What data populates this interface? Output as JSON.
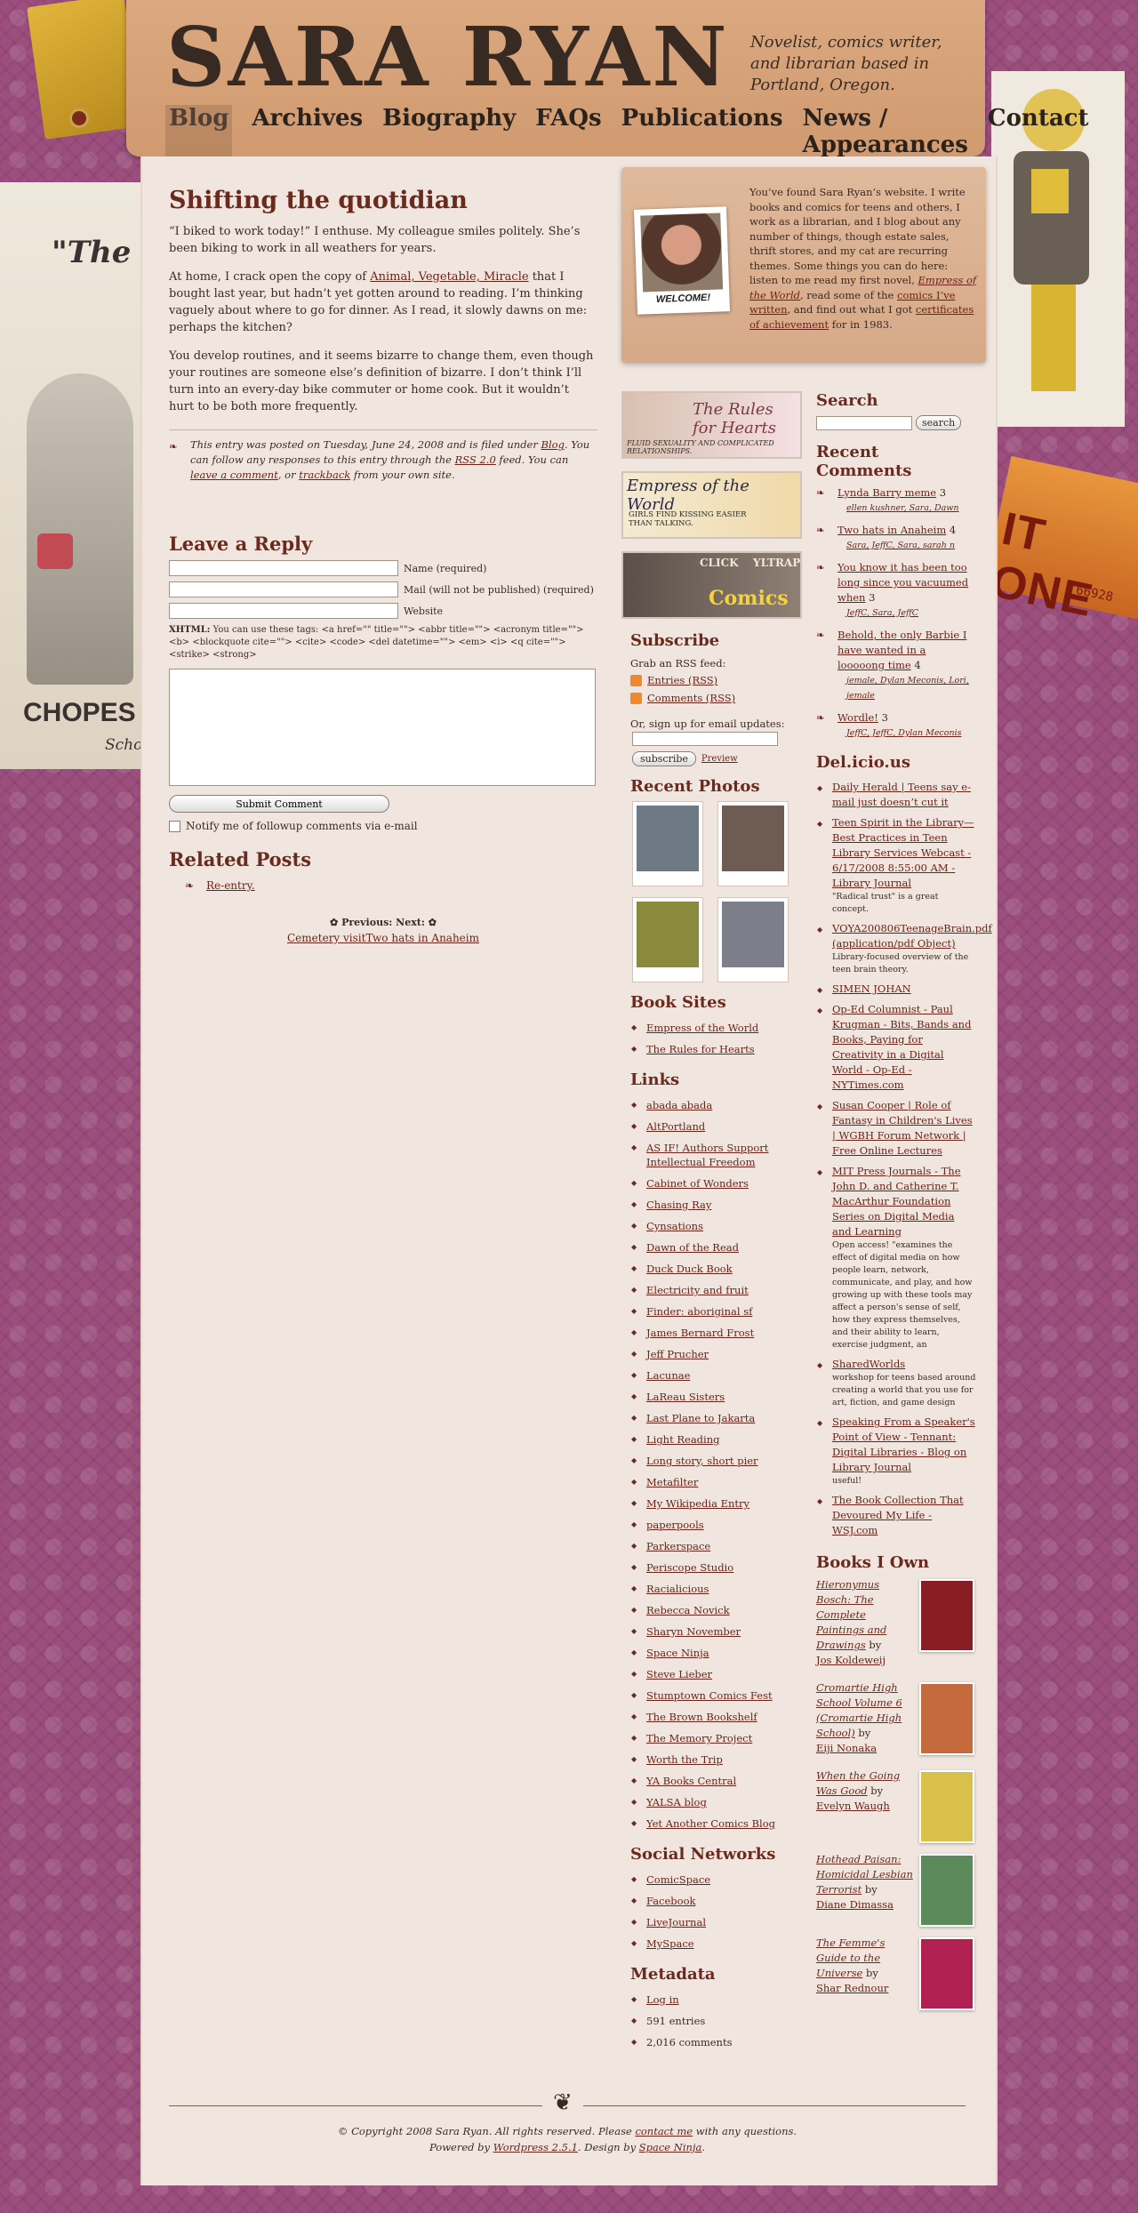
{
  "site": {
    "title": "SARA RYAN",
    "tagline": "Novelist, comics writer, and librarian based in Portland, Oregon."
  },
  "nav": [
    "Blog",
    "Archives",
    "Biography",
    "FAQs",
    "Publications",
    "News / Appearances",
    "Contact"
  ],
  "decor": {
    "poster_quote": "\"The Ri Answe Your I",
    "poster_bottom": "CHOPES",
    "poster_sub": "Scho",
    "ticket_text": "IT ONE",
    "ticket_num": "66928"
  },
  "post": {
    "title": "Shifting the quotidian",
    "p1": "“I biked to work today!” I enthuse. My colleague smiles politely. She’s been biking to work in all weathers for years.",
    "p2_before": "At home, I crack open the copy of ",
    "p2_link": "Animal, Vegetable, Miracle",
    "p2_after": " that I bought last year, but hadn’t yet gotten around to reading. I’m thinking vaguely about where to go for dinner. As I read, it slowly dawns on me: perhaps the kitchen?",
    "p3": "You develop routines, and it seems bizarre to change them, even though your routines are someone else’s definition of bizarre. I don’t think I’ll turn into an every-day bike commuter or home cook. But it wouldn’t hurt to be both more frequently.",
    "meta": {
      "a": "This entry was posted on Tuesday, June 24, 2008 and is filed under ",
      "cat": "Blog",
      "b": ". You can follow any responses to this entry through the ",
      "rss": "RSS 2.0",
      "c": " feed. You can ",
      "leave": "leave a comment",
      "d": ", or ",
      "trackback": "trackback",
      "e": " from your own site."
    }
  },
  "reply": {
    "heading": "Leave a Reply",
    "name_label": "Name (required)",
    "mail_label": "Mail (will not be published) (required)",
    "website_label": "Website",
    "xhtml_label": "XHTML:",
    "xhtml_text": " You can use these tags: <a href=\"\" title=\"\"> <abbr title=\"\"> <acronym title=\"\"> <b> <blockquote cite=\"\"> <cite> <code> <del datetime=\"\"> <em> <i> <q cite=\"\"> <strike> <strong>",
    "submit": "Submit Comment",
    "notify": "Notify me of followup comments via e-mail"
  },
  "related": {
    "heading": "Related Posts",
    "items": [
      "Re-entry."
    ],
    "prevnext": "Previous: Next:",
    "prev_link": "Cemetery visit",
    "next_link": "Two hats in Anaheim"
  },
  "intro": {
    "welcome": "WELCOME!",
    "t1": "You’ve found Sara Ryan’s website. I write books and comics for teens and others, I work as a librarian, and I blog about any number of things, though estate sales, thrift stores, and my cat are recurring themes. Some things you can do here: listen to me read my first novel, ",
    "l1": "Empress of the World",
    "t2": ", read some of the ",
    "l2": "comics I’ve written",
    "t3": ", and find out what I got ",
    "l3": "certificates of achievement",
    "t4": " for in 1983."
  },
  "banners": {
    "b1_title": "The Rules for Hearts",
    "b1_sub": "FLUID SEXUALITY AND COMPLICATED RELATIONSHIPS.",
    "b2_title": "Empress of the World",
    "b2_sub": "GIRLS FIND KISSING EASIER THAN TALKING.",
    "b3_title": "Comics",
    "b3_click": "CLICK",
    "b3_trap": "TRAP",
    "b3_yl": "YLTRAP"
  },
  "subscribe": {
    "heading": "Subscribe",
    "rss_label": "Grab an RSS feed:",
    "entries": "Entries (RSS)",
    "comments": "Comments (RSS)",
    "email_label": "Or, sign up for email updates:",
    "button": "subscribe",
    "preview": "Preview"
  },
  "photos": {
    "heading": "Recent Photos",
    "items": [
      {
        "color": "#6d7a86"
      },
      {
        "color": "#6e5c52"
      },
      {
        "color": "#8a8a3c"
      },
      {
        "color": "#7d7e89"
      }
    ]
  },
  "book_sites": {
    "heading": "Book Sites",
    "items": [
      "Empress of the World",
      "The Rules for Hearts"
    ]
  },
  "links": {
    "heading": "Links",
    "items": [
      "abada abada",
      "AltPortland",
      "AS IF! Authors Support Intellectual Freedom",
      "Cabinet of Wonders",
      "Chasing Ray",
      "Cynsations",
      "Dawn of the Read",
      "Duck Duck Book",
      "Electricity and fruit",
      "Finder: aboriginal sf",
      "James Bernard Frost",
      "Jeff Prucher",
      "Lacunae",
      "LaReau Sisters",
      "Last Plane to Jakarta",
      "Light Reading",
      "Long story, short pier",
      "Metafilter",
      "My Wikipedia Entry",
      "paperpools",
      "Parkerspace",
      "Periscope Studio",
      "Racialicious",
      "Rebecca Novick",
      "Sharyn November",
      "Space Ninja",
      "Steve Lieber",
      "Stumptown Comics Fest",
      "The Brown Bookshelf",
      "The Memory Project",
      "Worth the Trip",
      "YA Books Central",
      "YALSA blog",
      "Yet Another Comics Blog"
    ]
  },
  "social": {
    "heading": "Social Networks",
    "items": [
      "ComicSpace",
      "Facebook",
      "LiveJournal",
      "MySpace"
    ]
  },
  "metadata": {
    "heading": "Metadata",
    "items": [
      "Log in",
      "591 entries",
      "2,016 comments"
    ]
  },
  "search": {
    "heading": "Search",
    "button": "search"
  },
  "recent_comments": {
    "heading": "Recent Comments",
    "items": [
      {
        "title": "Lynda Barry meme",
        "count": "3",
        "who": "ellen kushner, Sara, Dawn"
      },
      {
        "title": "Two hats in Anaheim",
        "count": "4",
        "who": "Sara, JeffC, Sara, sarah n"
      },
      {
        "title": "You know it has been too long since you vacuumed when",
        "count": "3",
        "who": "JeffC, Sara, JeffC"
      },
      {
        "title": "Behold, the only Barbie I have wanted in a looooong time",
        "count": "4",
        "who": "jemale, Dylan Meconis, Lori, jemale"
      },
      {
        "title": "Wordle!",
        "count": "3",
        "who": "JeffC, JeffC, Dylan Meconis"
      }
    ]
  },
  "delicious": {
    "heading": "Del.icio.us",
    "items": [
      {
        "title": "Daily Herald | Teens say e-mail just doesn’t cut it",
        "note": ""
      },
      {
        "title": "Teen Spirit in the Library—Best Practices in Teen Library Services Webcast - 6/17/2008 8:55:00 AM - Library Journal",
        "note": "\"Radical trust\" is a great concept."
      },
      {
        "title": "VOYA200806TeenageBrain.pdf (application/pdf Object)",
        "note": "Library-focused overview of the teen brain theory."
      },
      {
        "title": "SIMEN JOHAN",
        "note": ""
      },
      {
        "title": "Op-Ed Columnist - Paul Krugman - Bits, Bands and Books, Paying for Creativity in a Digital World - Op-Ed - NYTimes.com",
        "note": ""
      },
      {
        "title": "Susan Cooper | Role of Fantasy in Children's Lives | WGBH Forum Network | Free Online Lectures",
        "note": ""
      },
      {
        "title": "MIT Press Journals - The John D. and Catherine T. MacArthur Foundation Series on Digital Media and Learning",
        "note": "Open access! \"examines the effect of digital media on how people learn, network, communicate, and play, and how growing up with these tools may affect a person's sense of self, how they express themselves, and their ability to learn, exercise judgment, an"
      },
      {
        "title": "SharedWorlds",
        "note": "workshop for teens based around creating a world that you use for art, fiction, and game design"
      },
      {
        "title": "Speaking From a Speaker's Point of View - Tennant: Digital Libraries - Blog on Library Journal",
        "note": "useful!"
      },
      {
        "title": "The Book Collection That Devoured My Life - WSJ.com",
        "note": ""
      }
    ]
  },
  "books": {
    "heading": "Books I Own",
    "by": "by",
    "items": [
      {
        "title": "Hieronymus Bosch: The Complete Paintings and Drawings",
        "author": "Jos Koldeweij",
        "color": "#8a1c24"
      },
      {
        "title": "Cromartie High School Volume 6 (Cromartie High School)",
        "author": "Eiji Nonaka",
        "color": "#c56a3d"
      },
      {
        "title": "When the Going Was Good",
        "author": "Evelyn Waugh",
        "color": "#d8c04a"
      },
      {
        "title": "Hothead Paisan: Homicidal Lesbian Terrorist",
        "author": "Diane Dimassa",
        "color": "#5d8a5b"
      },
      {
        "title": "The Femme's Guide to the Universe",
        "author": "Shar Rednour",
        "color": "#b02050"
      }
    ]
  },
  "footer": {
    "line1_a": "© Copyright 2008 Sara Ryan. All rights reserved. Please ",
    "contact": "contact me",
    "line1_b": " with any questions.",
    "line2_a": "Powered by ",
    "wp": "Wordpress 2.5.1",
    "line2_b": ". Design by ",
    "sn": "Space Ninja",
    "line2_c": "."
  }
}
